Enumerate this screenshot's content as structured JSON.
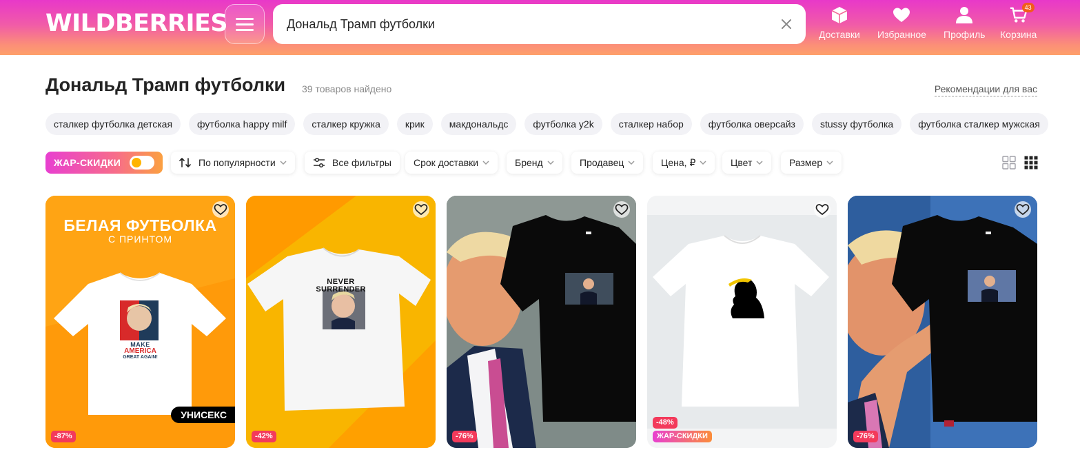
{
  "header": {
    "logo": "WILDBERRIES",
    "search_value": "Дональд Трамп футболки",
    "nav": [
      {
        "label": "Доставки",
        "icon": "box-icon"
      },
      {
        "label": "Избранное",
        "icon": "heart-icon"
      },
      {
        "label": "Профиль",
        "icon": "user-icon"
      },
      {
        "label": "Корзина",
        "icon": "cart-icon",
        "badge": "43"
      }
    ]
  },
  "title": {
    "heading": "Дональд Трамп футболки",
    "count": "39 товаров найдено",
    "recommendations": "Рекомендации для вас"
  },
  "chips": [
    "сталкер футболка детская",
    "футболка happy milf",
    "сталкер кружка",
    "крик",
    "макдональдс",
    "футболка y2k",
    "сталкер набор",
    "футболка оверсайз",
    "stussy футболка",
    "футболка сталкер мужская"
  ],
  "filters": {
    "hot_sale": "ЖАР-СКИДКИ",
    "sort": "По популярности",
    "all_filters": "Все фильтры",
    "delivery": "Срок доставки",
    "brand": "Бренд",
    "seller": "Продавец",
    "price": "Цена, ₽",
    "color": "Цвет",
    "size": "Размер"
  },
  "cards": [
    {
      "discount": "-87%",
      "promo_title": "БЕЛАЯ ФУТБОЛКА",
      "promo_sub": "С ПРИНТОМ",
      "badge": "УНИСЕКС",
      "print_line1": "MAKE",
      "print_line2": "AMERICA",
      "print_line3": "GREAT AGAIN!"
    },
    {
      "discount": "-42%",
      "print_line1": "NEVER",
      "print_line2": "SURRENDER"
    },
    {
      "discount": "-76%"
    },
    {
      "discount": "-48%",
      "hot_tag": "ЖАР-СКИДКИ"
    },
    {
      "discount": "-76%"
    }
  ],
  "colors": {
    "accent": "#cb11ab",
    "discount": "#f33a5b",
    "card1_bg": "#ffa30f",
    "card2_bg": "#f8b400"
  }
}
